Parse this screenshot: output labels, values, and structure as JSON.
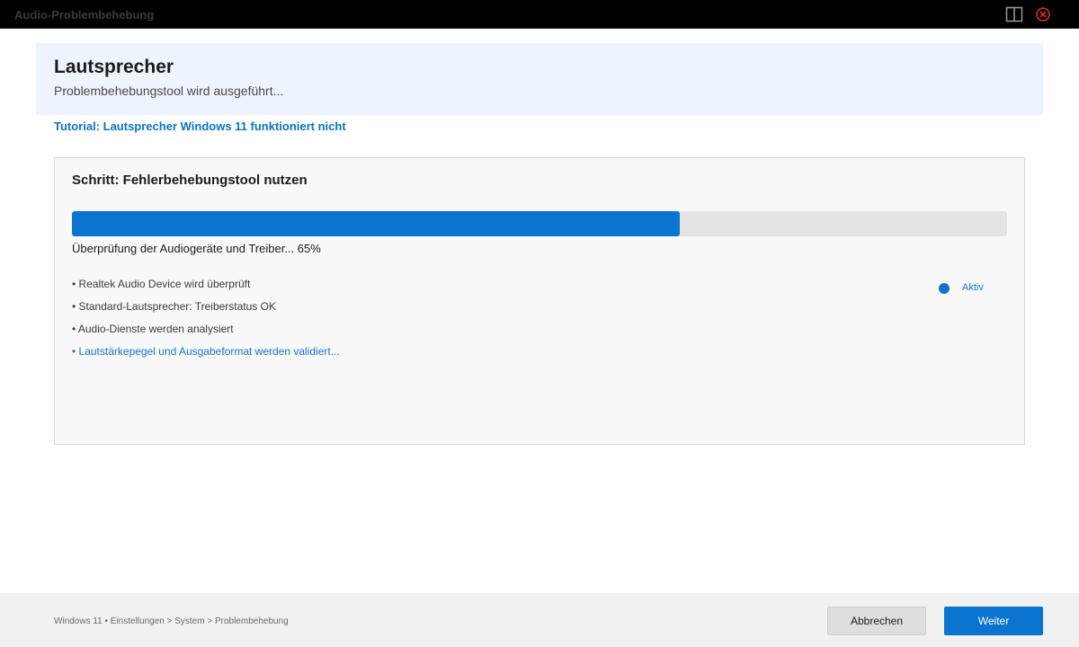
{
  "window": {
    "title": "Audio-Problembehebung"
  },
  "header": {
    "title": "Lautsprecher",
    "subtitle": "Problembehebungstool wird ausgeführt..."
  },
  "tutorial_link": "Tutorial: Lautsprecher Windows 11 funktioniert nicht",
  "step": {
    "title": "Schritt: Fehlerbehebungstool nutzen",
    "progress_percent": 65,
    "progress_text": "Überprüfung der Audiogeräte und Treiber... 65%",
    "items": [
      {
        "label": "• Realtek Audio Device wird überprüft",
        "active": false
      },
      {
        "label": "• Standard-Lautsprecher: Treiberstatus OK",
        "active": false
      },
      {
        "label": "• Audio-Dienste werden analysiert",
        "active": false
      },
      {
        "label": "• Lautstärkepegel und Ausgabeformat werden validiert...",
        "active": true
      }
    ],
    "status_label": "Aktiv"
  },
  "footer": {
    "breadcrumb": "Windows 11 • Einstellungen > System > Problembehebung",
    "cancel_label": "Abbrechen",
    "next_label": "Weiter"
  },
  "icons": {
    "split_view": "split-view-icon",
    "close": "close-circle-icon"
  },
  "colors": {
    "accent": "#0b74d1",
    "close_icon": "#d93025",
    "header_bg": "#eef4fc",
    "titlebar_bg": "#000000"
  }
}
